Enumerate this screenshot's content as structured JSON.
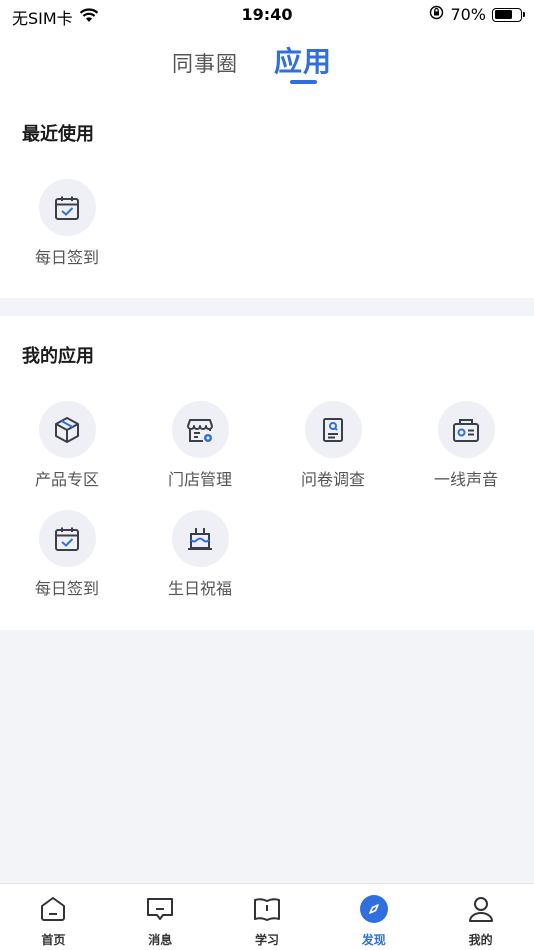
{
  "status_bar": {
    "carrier": "无SIM卡",
    "time": "19:40",
    "battery_percent": "70%",
    "battery_level": 0.7
  },
  "header_tabs": {
    "colleague": "同事圈",
    "apps": "应用",
    "active": "apps"
  },
  "recent": {
    "title": "最近使用",
    "items": [
      {
        "label": "每日签到",
        "icon": "calendar-check-icon"
      }
    ]
  },
  "my_apps": {
    "title": "我的应用",
    "items": [
      {
        "label": "产品专区",
        "icon": "cube-icon"
      },
      {
        "label": "门店管理",
        "icon": "store-settings-icon"
      },
      {
        "label": "问卷调查",
        "icon": "survey-icon"
      },
      {
        "label": "一线声音",
        "icon": "radio-icon"
      },
      {
        "label": "每日签到",
        "icon": "calendar-check-icon"
      },
      {
        "label": "生日祝福",
        "icon": "birthday-cake-icon"
      }
    ]
  },
  "tab_bar": {
    "items": [
      {
        "label": "首页",
        "icon": "home-icon"
      },
      {
        "label": "消息",
        "icon": "message-icon"
      },
      {
        "label": "学习",
        "icon": "book-icon"
      },
      {
        "label": "发现",
        "icon": "compass-icon"
      },
      {
        "label": "我的",
        "icon": "user-icon"
      }
    ],
    "active_index": 3
  },
  "colors": {
    "accent": "#2f6fe0",
    "icon_stroke": "#3a3f4a",
    "page_bg": "#f3f4f7"
  }
}
